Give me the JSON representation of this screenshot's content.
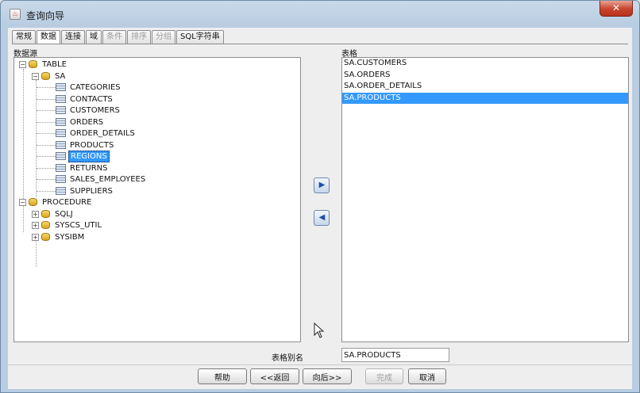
{
  "window": {
    "title": "查询向导",
    "close_label": "✕"
  },
  "tabs": [
    {
      "label": "常规",
      "state": "normal"
    },
    {
      "label": "数据",
      "state": "active"
    },
    {
      "label": "连接",
      "state": "normal"
    },
    {
      "label": "域",
      "state": "normal"
    },
    {
      "label": "条件",
      "state": "disabled"
    },
    {
      "label": "排序",
      "state": "disabled"
    },
    {
      "label": "分组",
      "state": "disabled"
    },
    {
      "label": "SQL字符串",
      "state": "normal"
    }
  ],
  "datasource": {
    "label": "数据源",
    "tree": {
      "table_root": "TABLE",
      "schema": "SA",
      "tables": [
        "CATEGORIES",
        "CONTACTS",
        "CUSTOMERS",
        "ORDERS",
        "ORDER_DETAILS",
        "PRODUCTS",
        "REGIONS",
        "RETURNS",
        "SALES_EMPLOYEES",
        "SUPPLIERS"
      ],
      "selected_table": "REGIONS",
      "procedure_root": "PROCEDURE",
      "procedure_children": [
        "SQLJ",
        "SYSCS_UTIL",
        "SYSIBM"
      ]
    }
  },
  "tables_panel": {
    "label": "表格",
    "items": [
      "SA.CUSTOMERS",
      "SA.ORDERS",
      "SA.ORDER_DETAILS",
      "SA.PRODUCTS"
    ],
    "selected": "SA.PRODUCTS"
  },
  "alias": {
    "label": "表格别名",
    "value": "SA.PRODUCTS"
  },
  "buttons": {
    "help": "帮助",
    "back": "<<返回",
    "next": "向后>>",
    "finish": "完成",
    "cancel": "取消"
  },
  "colors": {
    "selection": "#3399ff"
  }
}
